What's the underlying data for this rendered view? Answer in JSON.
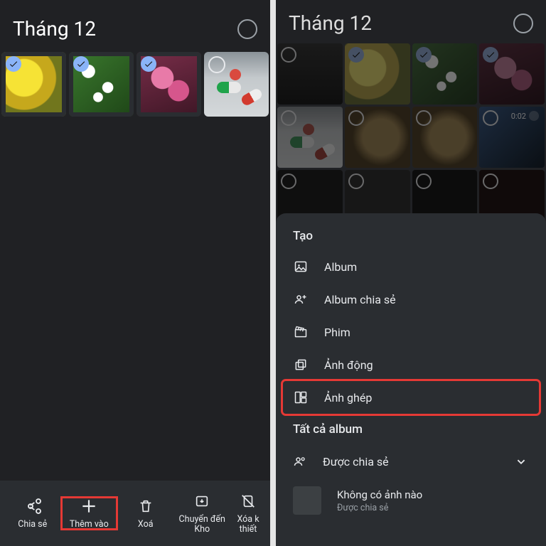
{
  "left": {
    "title": "Tháng 12",
    "actions": [
      {
        "label": "Chia sẻ"
      },
      {
        "label": "Thêm vào"
      },
      {
        "label": "Xoá"
      },
      {
        "label": "Chuyển đến Kho"
      },
      {
        "label": "Xóa k thiết"
      }
    ]
  },
  "right": {
    "title": "Tháng 12",
    "video_duration": "0:02",
    "create_heading": "Tạo",
    "create_options": [
      "Album",
      "Album chia sẻ",
      "Phim",
      "Ảnh động",
      "Ảnh ghép"
    ],
    "all_albums_heading": "Tất cả album",
    "shared_label": "Được chia sẻ",
    "no_album": {
      "title": "Không có ảnh nào",
      "subtitle": "Được chia sẻ"
    }
  }
}
